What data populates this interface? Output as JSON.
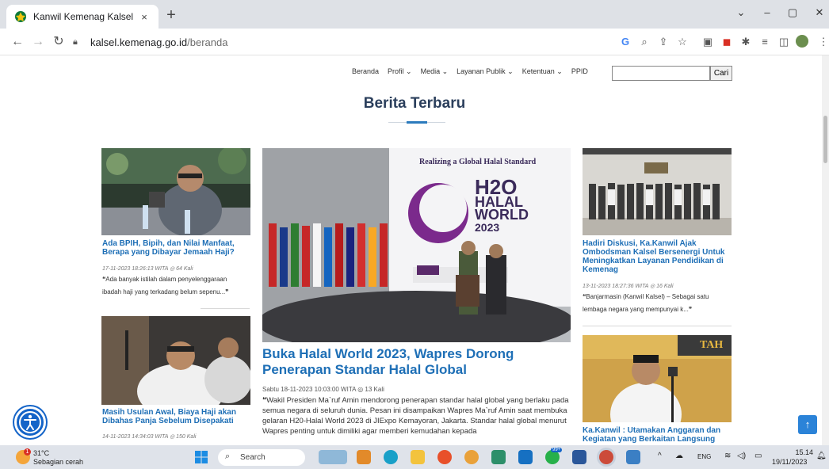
{
  "browser": {
    "tab_title": "Kanwil Kemenag Kalsel",
    "tab_close": "×",
    "new_tab": "+",
    "url_host": "kalsel.kemenag.go.id",
    "url_path": "/beranda",
    "window": {
      "minimize": "–",
      "maximize": "▢",
      "close": "✕",
      "tabsearch": "⌄"
    }
  },
  "site_nav": {
    "items": [
      "Beranda",
      "Profil ⌄",
      "Media ⌄",
      "Layanan Publik ⌄",
      "Ketentuan ⌄",
      "PPID"
    ],
    "search_placeholder": "",
    "search_button": "Cari"
  },
  "section_title": "Berita Terbaru",
  "articles": {
    "left_1": {
      "title": "Ada BPIH, Bipih, dan Nilai Manfaat, Berapa yang Dibayar Jemaah Haji?",
      "meta": "17-11-2023 18:26:13 WITA  ◎ 64 Kali",
      "excerpt": "❝Ada banyak istilah dalam penyelenggaraan ibadah haji yang terkadang belum sepenu...❞"
    },
    "left_2": {
      "title": "Masih Usulan Awal, Biaya Haji akan Dibahas Panja Sebelum Disepakati",
      "meta": "14-11-2023 14:34:03 WITA  ◎ 150 Kali"
    },
    "center": {
      "banner_heading": "Realizing a Global Halal Standard",
      "banner_h20": "H2O",
      "banner_halal": "HALAL",
      "banner_world": "WORLD",
      "banner_year": "2023",
      "title": "Buka Halal World 2023, Wapres Dorong Penerapan Standar Halal Global",
      "meta": "Sabtu 18-11-2023 10:03:00 WITA  ◎ 13 Kali",
      "excerpt": "❝Wakil Presiden Ma`ruf Amin mendorong penerapan standar halal global yang berlaku pada semua negara di seluruh dunia.  Pesan ini disampaikan Wapres Ma`ruf Amin saat membuka gelaran H20-Halal World 2023 di JIExpo Kemayoran, Jakarta. Standar halal global menurut Wapres penting untuk dimiliki agar memberi kemudahan kepada"
    },
    "right_1": {
      "title": "Hadiri Diskusi, Ka.Kanwil Ajak Ombodsman Kalsel Bersenergi Untuk Meningkatkan Layanan Pendidikan di Kemenag",
      "meta": "13-11-2023 18:27:36 WITA  ◎ 16 Kali",
      "excerpt": "❝Banjarmasin (Kanwil Kalsel) – Sebagai satu lembaga negara yang mempunyai k...❞"
    },
    "right_2": {
      "banner_text": "TAH",
      "title": "Ka.Kanwil : Utamakan Anggaran dan Kegiatan yang Berkaitan Langsung"
    }
  },
  "taskbar": {
    "weather_temp": "31°C",
    "weather_desc": "Sebagian cerah",
    "weather_badge": "1",
    "search_label": "Search",
    "notif_badge": "99+",
    "lang": "ENG",
    "time": "15.14",
    "date": "19/11/2023"
  },
  "colors": {
    "link_blue": "#1e6fb6",
    "title_navy": "#2b3f5c",
    "accent": "#2b7bbd",
    "taskbar_bg": "#dfe3ea",
    "tabbar_bg": "#dee1e6"
  },
  "icons": {
    "back": "back-arrow-icon",
    "forward": "forward-arrow-icon",
    "reload": "reload-icon",
    "lock": "lock-icon",
    "accessibility": "accessibility-icon",
    "scroll_top": "arrow-up-icon"
  }
}
